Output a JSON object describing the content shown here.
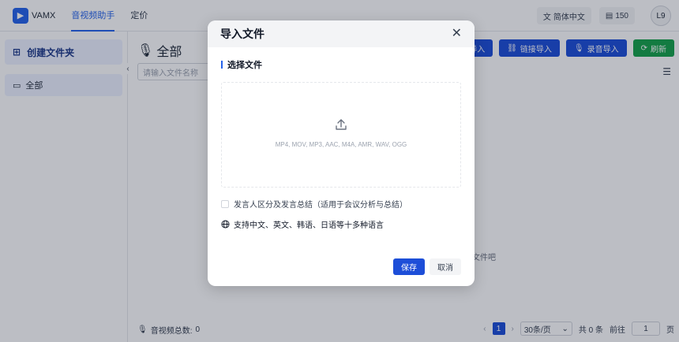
{
  "app": {
    "name": "VAMX"
  },
  "nav": {
    "tab_assistant": "音视频助手",
    "tab_pricing": "定价"
  },
  "header": {
    "language": "简体中文",
    "credits": "150",
    "avatar": "L9"
  },
  "sidebar": {
    "create_folder": "创建文件夹",
    "folder_all": "全部"
  },
  "main": {
    "title": "全部",
    "search_placeholder": "请输入文件名称",
    "buttons": {
      "import": "导入",
      "link_import": "链接导入",
      "record_import": "录音导入",
      "refresh": "刷新"
    },
    "empty_text": "文件吧",
    "footer_total_label": "音视频总数:",
    "footer_total_value": "0",
    "pager": {
      "page": "1",
      "page_size": "30条/页",
      "total": "共 0 条",
      "goto_label": "前往",
      "goto_value": "1",
      "page_unit": "页"
    }
  },
  "modal": {
    "title": "导入文件",
    "section_title": "选择文件",
    "formats": "MP4, MOV, MP3, AAC, M4A, AMR, WAV, OGG",
    "speaker_option": "发言人区分及发言总结（适用于会议分析与总结）",
    "language_note": "支持中文、英文、韩语、日语等十多种语言",
    "save": "保存",
    "cancel": "取消"
  },
  "colors": {
    "primary": "#1d4ed8",
    "success": "#16a34a",
    "overlay": "rgba(15,23,42,0.28)"
  },
  "icons": [
    "logo-icon",
    "translate-icon",
    "credits-icon",
    "folder-plus-icon",
    "folder-icon",
    "chevron-left-icon",
    "mic-icon",
    "link-icon",
    "refresh-icon",
    "list-view-icon",
    "close-icon",
    "upload-icon",
    "globe-icon"
  ]
}
